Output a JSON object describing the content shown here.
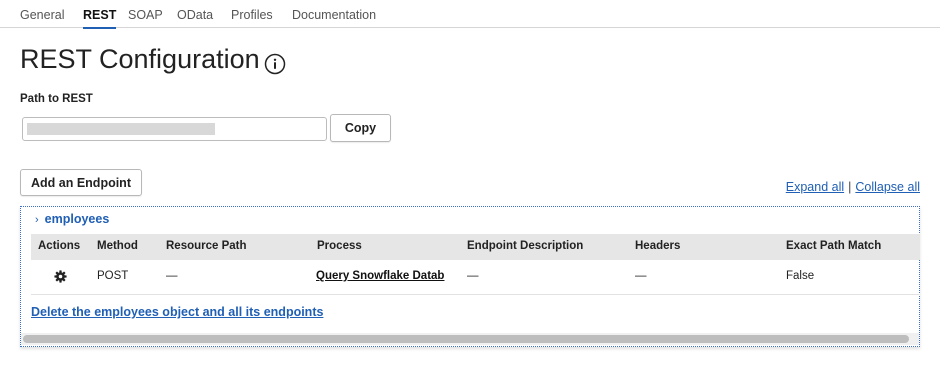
{
  "tabs": [
    {
      "label": "General"
    },
    {
      "label": "REST",
      "active": true
    },
    {
      "label": "SOAP"
    },
    {
      "label": "OData"
    },
    {
      "label": "Profiles"
    },
    {
      "label": "Documentation"
    }
  ],
  "page": {
    "title": "REST Configuration",
    "info_icon": "info-circle-icon"
  },
  "path": {
    "label": "Path to REST",
    "value_redacted": true,
    "copy_label": "Copy"
  },
  "endpoints": {
    "add_label": "Add an Endpoint",
    "expand_all": "Expand all",
    "separator": "|",
    "collapse_all": "Collapse all"
  },
  "group": {
    "name": "employees",
    "chevron_icon": "chevron-right-icon",
    "columns": [
      "Actions",
      "Method",
      "Resource Path",
      "Process",
      "Endpoint Description",
      "Headers",
      "Exact Path Match"
    ],
    "rows": [
      {
        "action_icon": "gear-icon",
        "method": "POST",
        "resource_path": "—",
        "process": "Query Snowflake Datab",
        "description": "—",
        "headers": "—",
        "exact_path_match": "False"
      }
    ],
    "delete_label": "Delete the employees object and all its endpoints"
  },
  "colors": {
    "accent": "#1f5fb4",
    "header_bg": "#e6e6e6",
    "border": "#d6d6d6"
  }
}
